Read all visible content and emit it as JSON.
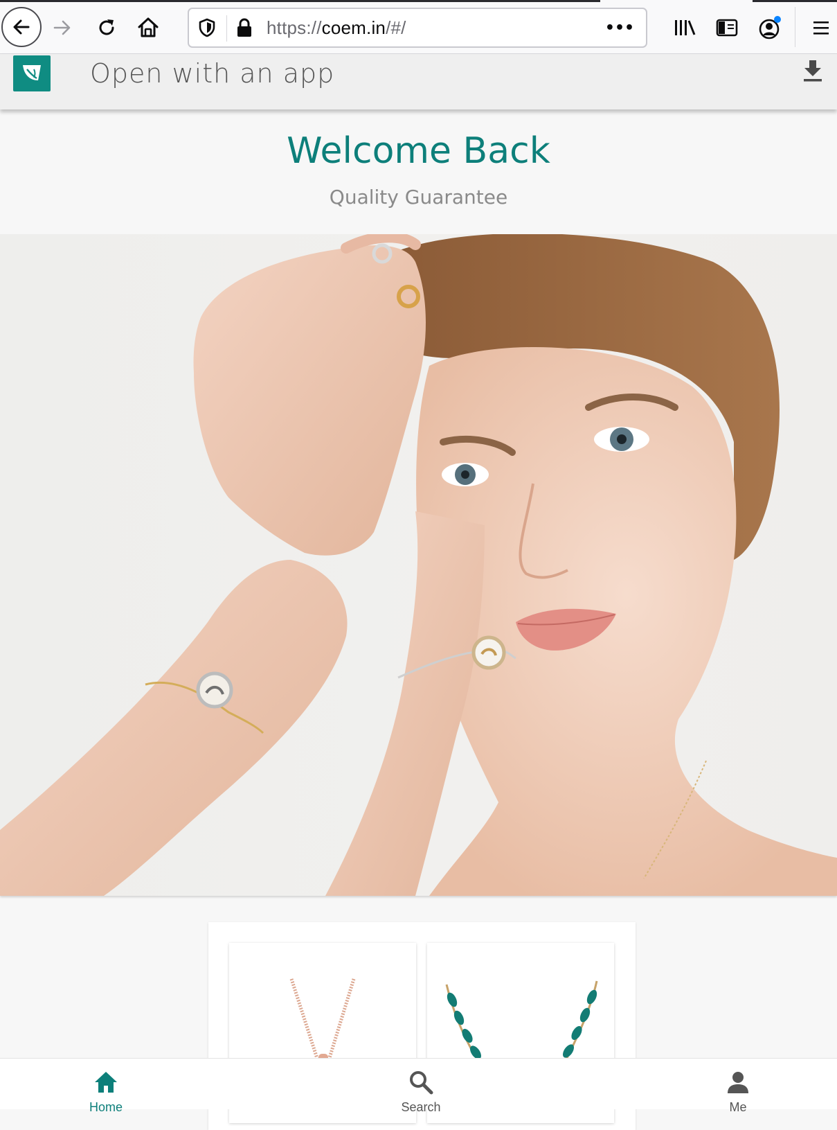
{
  "browser": {
    "url_scheme": "https://",
    "url_host": "coem.in",
    "url_path": "/#/",
    "page_actions_label": "•••"
  },
  "app_banner": {
    "text": "Open with an app"
  },
  "welcome": {
    "title": "Welcome Back",
    "subtitle": "Quality Guarantee"
  },
  "bottom_nav": {
    "items": [
      {
        "label": "Home",
        "icon": "home-icon",
        "active": true
      },
      {
        "label": "Search",
        "icon": "search-icon",
        "active": false
      },
      {
        "label": "Me",
        "icon": "user-icon",
        "active": false
      }
    ]
  },
  "colors": {
    "brand_teal": "#0d7f7a",
    "subtitle_gray": "#8a8a8a"
  }
}
